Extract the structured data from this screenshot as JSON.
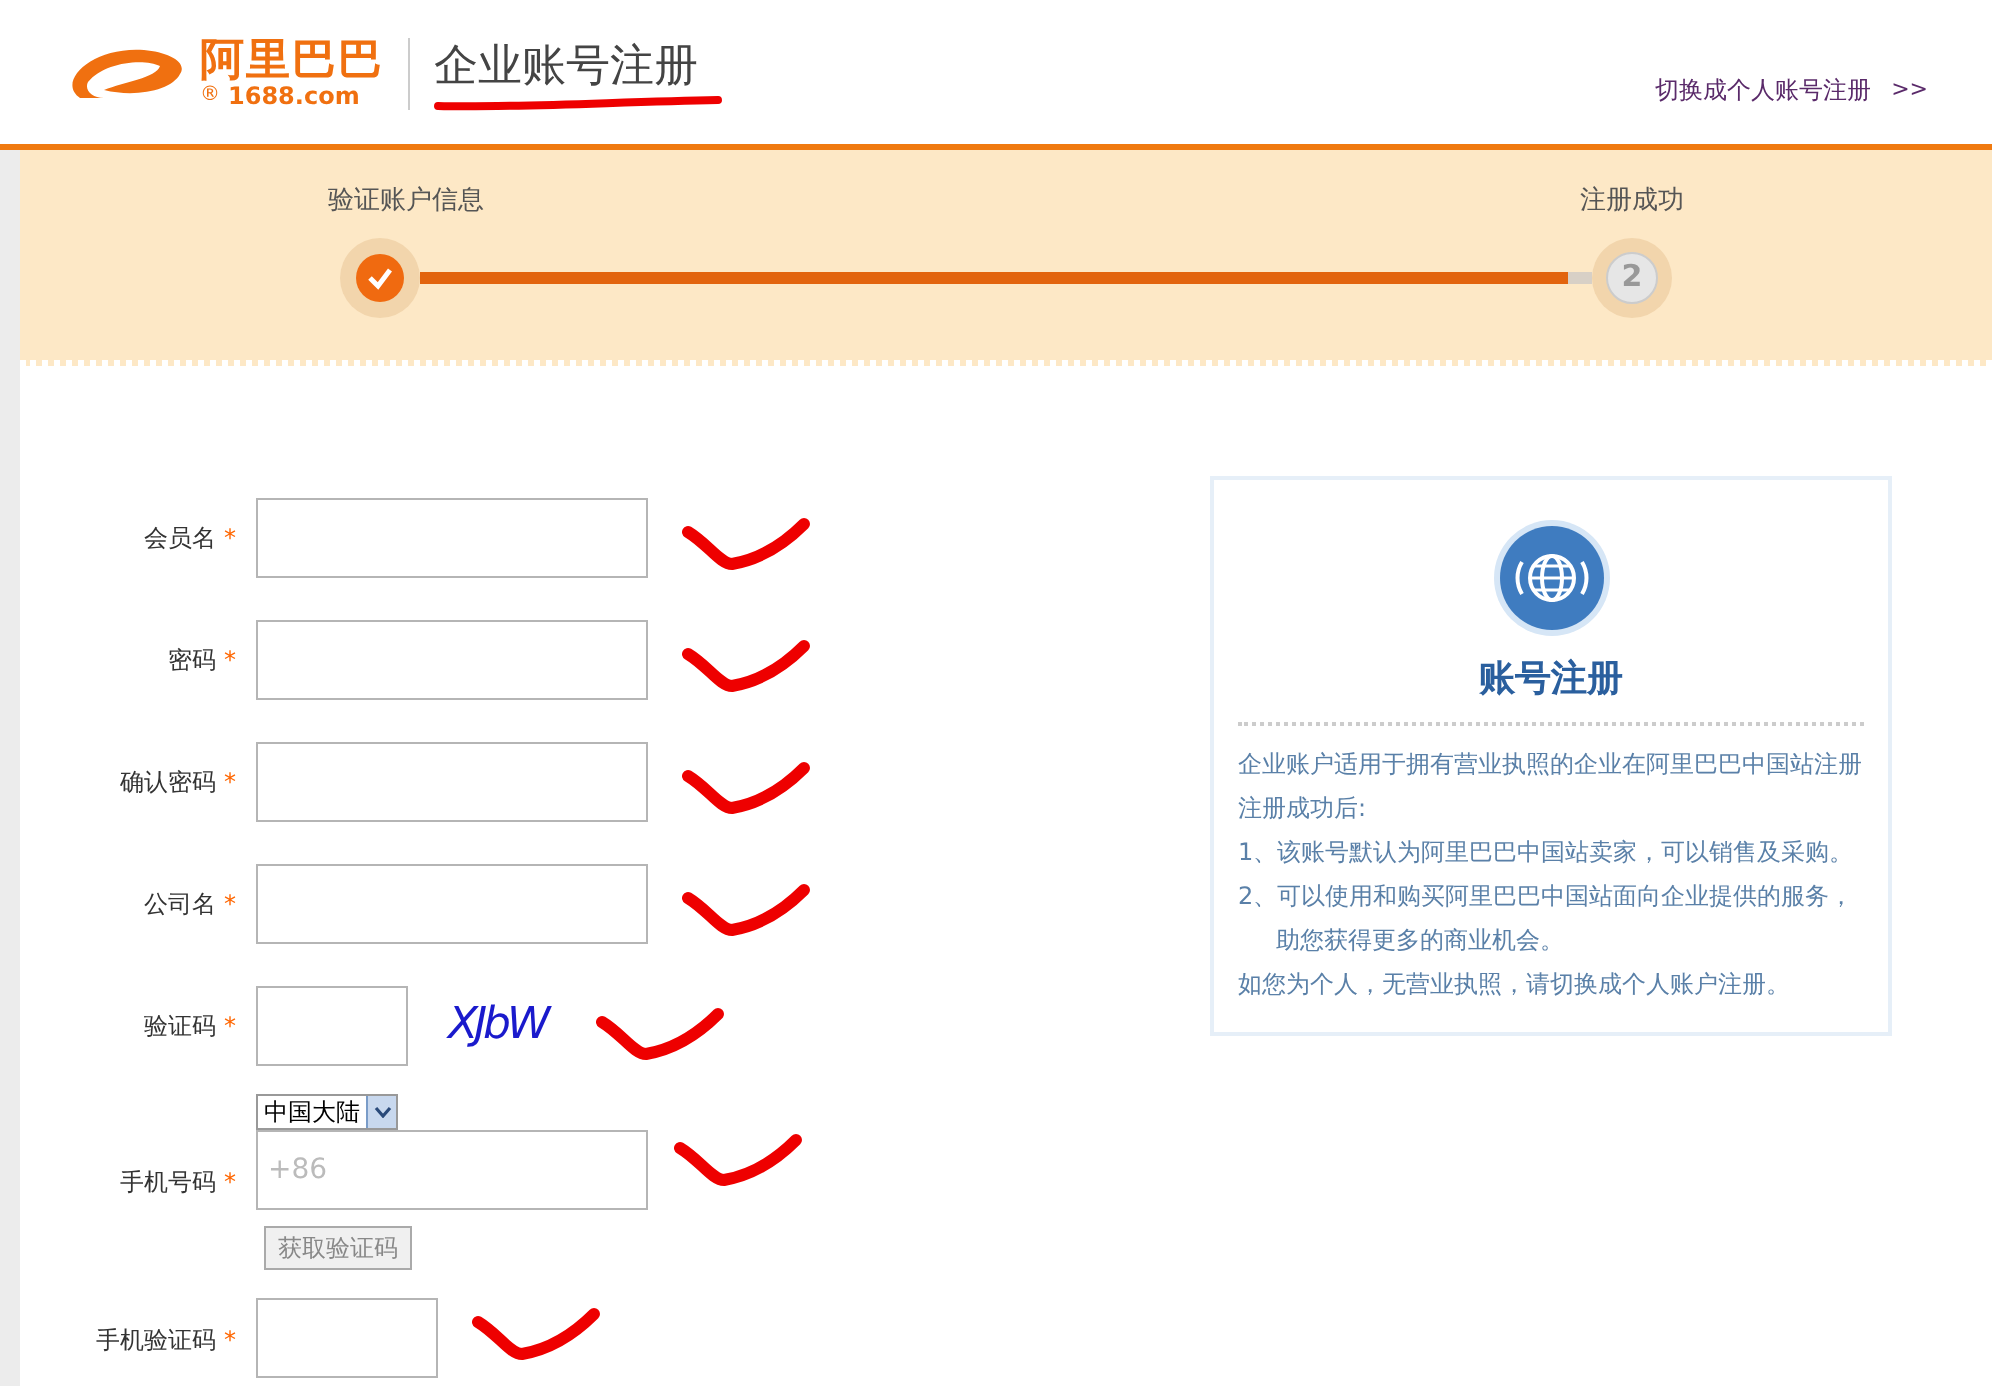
{
  "header": {
    "logo": {
      "name": "阿里巴巴",
      "mark": "®",
      "domain": "1688.com"
    },
    "title": "企业账号注册",
    "title_underlined": true,
    "switch_link": "切换成个人账号注册",
    "switch_arrow": ">>"
  },
  "steps": {
    "items": [
      {
        "label": "验证账户信息",
        "completed": true
      },
      {
        "label": "注册成功",
        "number": "2",
        "completed": false
      }
    ],
    "level": 0.98
  },
  "form": {
    "fields": [
      {
        "label": "会员名",
        "required": "*",
        "kind": "text",
        "annotated": true
      },
      {
        "label": "密码",
        "required": "*",
        "kind": "text",
        "annotated": true
      },
      {
        "label": "确认密码",
        "required": "*",
        "kind": "text",
        "annotated": true
      },
      {
        "label": "公司名",
        "required": "*",
        "kind": "text",
        "annotated": true
      },
      {
        "label": "验证码",
        "required": "*",
        "kind": "captcha",
        "captcha": "XJbW",
        "annotated": true
      },
      {
        "label": "手机号码",
        "required": "*",
        "kind": "phone",
        "region": "中国大陆",
        "placeholder": "+86",
        "button": "获取验证码",
        "annotated": true
      },
      {
        "label": "手机验证码",
        "required": "*",
        "kind": "short",
        "annotated": true
      }
    ]
  },
  "info_card": {
    "title": "账号注册",
    "lines": [
      {
        "text": "企业账户适用于拥有营业执照的企业在阿里巴巴中国站注册",
        "kind": "plain"
      },
      {
        "text": "注册成功后:",
        "kind": "plain"
      },
      {
        "text": "1、该账号默认为阿里巴巴中国站卖家，可以销售及采购。",
        "kind": "plain"
      },
      {
        "text": "2、可以使用和购买阿里巴巴中国站面向企业提供的服务，",
        "kind": "plain"
      },
      {
        "text": "助您获得更多的商业机会。",
        "kind": "indent"
      },
      {
        "text": "如您为个人，无营业执照，请切换成个人账户注册。",
        "kind": "plain"
      }
    ]
  }
}
